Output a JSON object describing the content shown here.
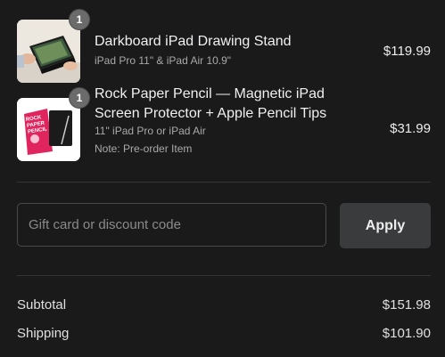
{
  "items": [
    {
      "quantity": "1",
      "title": "Darkboard iPad Drawing Stand",
      "variant": "iPad Pro 11\" & iPad Air 10.9\"",
      "note": "",
      "price": "$119.99",
      "thumbnail_icon": "drawing-stand-photo"
    },
    {
      "quantity": "1",
      "title": "Rock Paper Pencil — Magnetic iPad Screen Protector + Apple Pencil Tips",
      "variant": "11\" iPad Pro or iPad Air",
      "note": "Note: Pre-order Item",
      "price": "$31.99",
      "thumbnail_icon": "rock-paper-pencil-box",
      "thumbnail_box_text": "ROCK PAPER PENCIL"
    }
  ],
  "discount": {
    "placeholder": "Gift card or discount code",
    "value": "",
    "apply_label": "Apply"
  },
  "summary": {
    "subtotal_label": "Subtotal",
    "subtotal_value": "$151.98",
    "shipping_label": "Shipping",
    "shipping_value": "$101.90"
  },
  "colors": {
    "background": "#1a1a1b",
    "badge": "#6b6b6b",
    "button": "#3a3b3d",
    "accent_pink": "#e0245e"
  }
}
